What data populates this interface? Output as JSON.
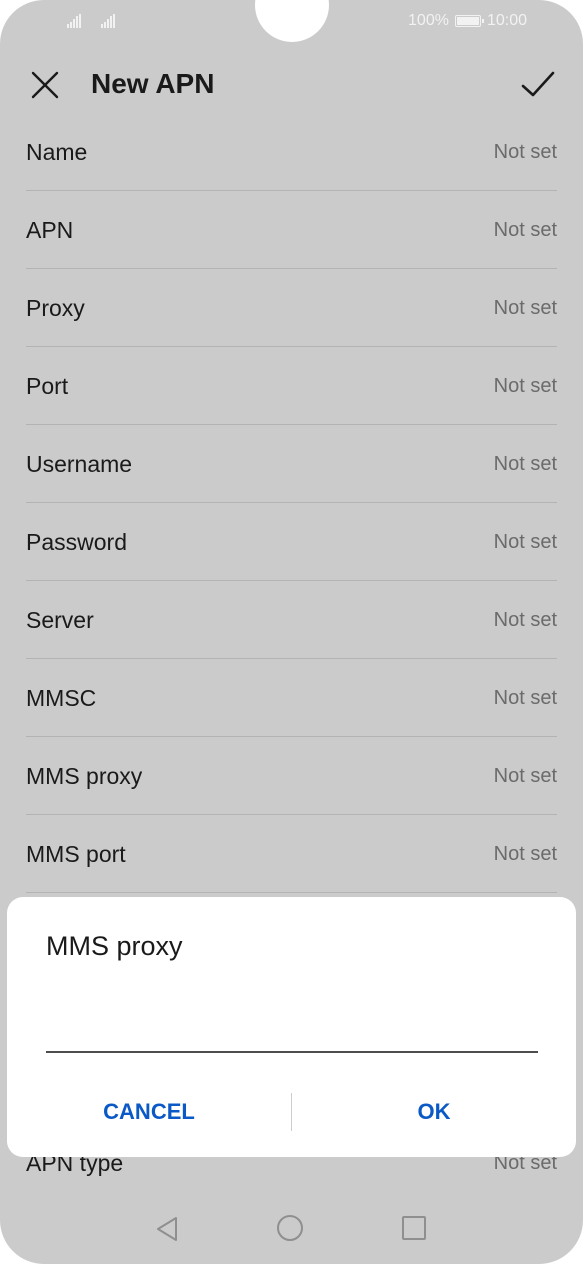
{
  "status_bar": {
    "battery_percent": "100%",
    "time": "10:00"
  },
  "toolbar": {
    "title": "New APN",
    "close_icon": "close-icon",
    "confirm_icon": "checkmark-icon"
  },
  "settings": [
    {
      "label": "Name",
      "value": "Not set"
    },
    {
      "label": "APN",
      "value": "Not set"
    },
    {
      "label": "Proxy",
      "value": "Not set"
    },
    {
      "label": "Port",
      "value": "Not set"
    },
    {
      "label": "Username",
      "value": "Not set"
    },
    {
      "label": "Password",
      "value": "Not set"
    },
    {
      "label": "Server",
      "value": "Not set"
    },
    {
      "label": "MMSC",
      "value": "Not set"
    },
    {
      "label": "MMS proxy",
      "value": "Not set"
    },
    {
      "label": "MMS port",
      "value": "Not set"
    }
  ],
  "apn_type": {
    "label": "APN type",
    "value": "Not set"
  },
  "dialog": {
    "title": "MMS proxy",
    "input_value": "",
    "cancel_label": "CANCEL",
    "ok_label": "OK"
  },
  "navigation": {
    "back_icon": "back-triangle-icon",
    "home_icon": "home-circle-icon",
    "recent_icon": "recent-apps-square-icon"
  },
  "colors": {
    "accent": "#0a59c6",
    "scrim_background": "#cbcbcb",
    "dialog_background": "#ffffff"
  }
}
